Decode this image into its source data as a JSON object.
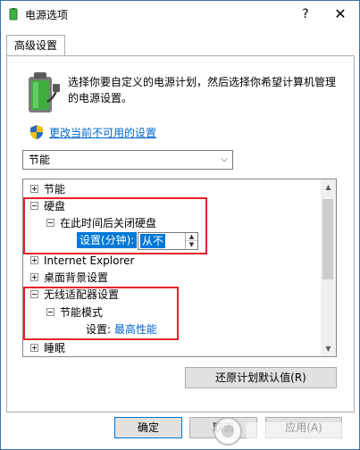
{
  "window": {
    "title": "电源选项",
    "help_glyph": "?",
    "close_glyph": "✕"
  },
  "tab": {
    "label": "高级设置"
  },
  "intro": {
    "text": "选择你要自定义的电源计划，然后选择你希望计算机管理的电源设置。"
  },
  "change_link": {
    "label": "更改当前不可用的设置"
  },
  "plan_select": {
    "value": "节能"
  },
  "tree": {
    "items": [
      {
        "label": "节能",
        "expander": "plus"
      },
      {
        "label": "硬盘",
        "expander": "minus"
      },
      {
        "label": "在此时间后关闭硬盘",
        "expander": "minus"
      },
      {
        "setting_label": "设置(分钟):",
        "value": "从不"
      },
      {
        "label": "Internet Explorer",
        "expander": "plus"
      },
      {
        "label": "桌面背景设置",
        "expander": "plus"
      },
      {
        "label": "无线适配器设置",
        "expander": "minus"
      },
      {
        "label": "节能模式",
        "expander": "minus"
      },
      {
        "setting_label": "设置:",
        "value": "最高性能"
      },
      {
        "label": "睡眠",
        "expander": "plus"
      }
    ]
  },
  "restore_button": {
    "label": "还原计划默认值(R)"
  },
  "buttons": {
    "ok": "确定",
    "cancel": "取消",
    "apply": "应用(A)"
  },
  "colors": {
    "link": "#0066cc",
    "selection": "#0078d7",
    "highlight_box": "#e8202a"
  }
}
